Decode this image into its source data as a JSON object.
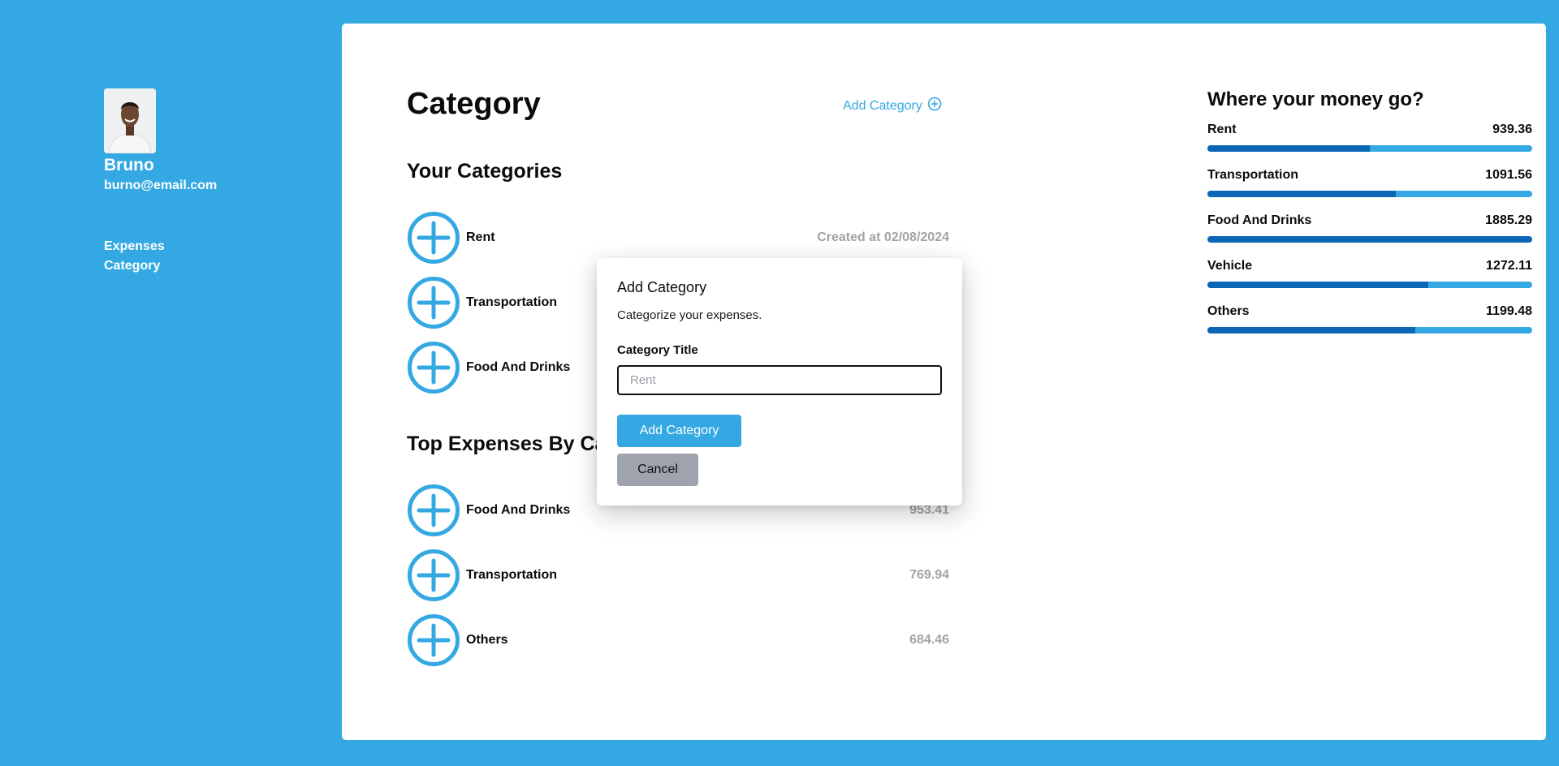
{
  "user": {
    "name": "Bruno",
    "email": "burno@email.com",
    "avatar_icon": "user-avatar"
  },
  "nav": [
    {
      "label": "Expenses"
    },
    {
      "label": "Category"
    }
  ],
  "page": {
    "title": "Category",
    "add_category_label": "Add Category"
  },
  "your_categories": {
    "title": "Your Categories",
    "items": [
      {
        "label": "Rent",
        "meta": "Created at 02/08/2024"
      },
      {
        "label": "Transportation",
        "meta": ""
      },
      {
        "label": "Food And Drinks",
        "meta": ""
      }
    ]
  },
  "top_expenses": {
    "title": "Top Expenses By Category",
    "items": [
      {
        "label": "Food And Drinks",
        "value": "953.41"
      },
      {
        "label": "Transportation",
        "value": "769.94"
      },
      {
        "label": "Others",
        "value": "684.46"
      }
    ]
  },
  "money": {
    "title": "Where your money go?",
    "items": [
      {
        "label": "Rent",
        "value": "939.36",
        "fill_pct": 50
      },
      {
        "label": "Transportation",
        "value": "1091.56",
        "fill_pct": 58
      },
      {
        "label": "Food And Drinks",
        "value": "1885.29",
        "fill_pct": 100
      },
      {
        "label": "Vehicle",
        "value": "1272.11",
        "fill_pct": 68
      },
      {
        "label": "Others",
        "value": "1199.48",
        "fill_pct": 64
      }
    ]
  },
  "modal": {
    "title": "Add Category",
    "description": "Categorize your expenses.",
    "field_label": "Category Title",
    "placeholder": "Rent",
    "value": "",
    "submit_label": "Add Category",
    "cancel_label": "Cancel"
  },
  "colors": {
    "background": "#34a8e3",
    "accent": "#34a8e3",
    "bar_fill": "#0b66b5",
    "muted_text": "#a3a3a3",
    "cancel_button": "#9ea3ad"
  }
}
